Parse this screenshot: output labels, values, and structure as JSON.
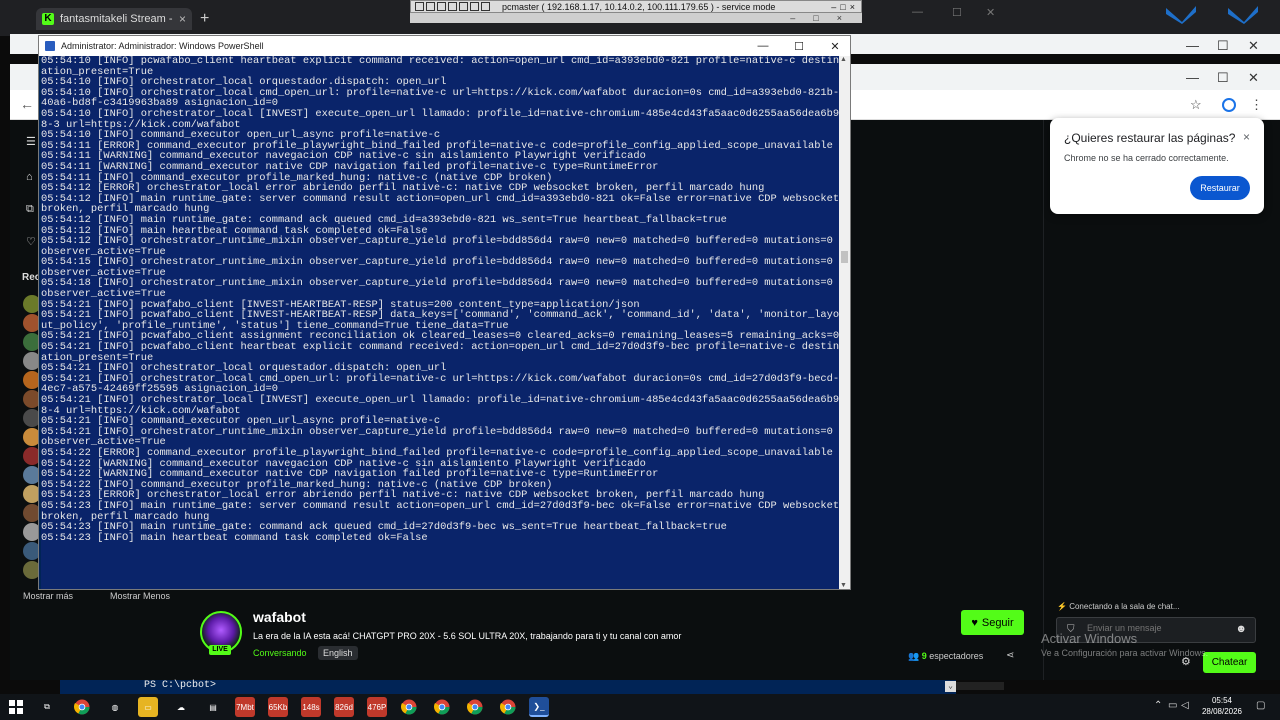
{
  "chrome": {
    "tab_title": "fantasmitakeli Stream - Watch",
    "tab_close": "×",
    "new_tab": "+",
    "kick_glyph": "K"
  },
  "service_bar": {
    "title": "pcmaster ( 192.168.1.17, 10.14.0.2, 100.111.179.65 ) - service mode",
    "min": "–",
    "max": "□",
    "close": "×"
  },
  "window_controls": {
    "min": "—",
    "max": "☐",
    "close": "✕"
  },
  "powershell": {
    "title": "Administrator: Administrador: Windows PowerShell",
    "lines": [
      "05:54:10 [INFO] pcwafabo_client heartbeat explicit command received: action=open_url cmd_id=a393ebd0-821 profile=native-c destination_present=True",
      "05:54:10 [INFO] orchestrator_local orquestador.dispatch: open_url",
      "05:54:10 [INFO] orchestrator_local cmd_open_url: profile=native-c url=https://kick.com/wafabot duracion=0s cmd_id=a393ebd0-821b-40a6-bd8f-c3419963ba89 asignacion_id=0",
      "05:54:10 [INFO] orchestrator_local [INVEST] execute_open_url llamado: profile_id=native-chromium-485e4cd43fa5aac0d6255aa56dea6b98-3 url=https://kick.com/wafabot",
      "05:54:10 [INFO] command_executor open_url_async profile=native-c",
      "05:54:11 [ERROR] command_executor profile_playwright_bind_failed profile=native-c code=profile_config_applied_scope_unavailable",
      "05:54:11 [WARNING] command_executor navegacion CDP native-c sin aislamiento Playwright verificado",
      "05:54:11 [WARNING] command_executor native CDP navigation failed profile=native-c type=RuntimeError",
      "05:54:11 [INFO] command_executor profile_marked_hung: native-c (native CDP broken)",
      "05:54:12 [ERROR] orchestrator_local error abriendo perfil native-c: native CDP websocket broken, perfil marcado hung",
      "05:54:12 [INFO] main runtime_gate: server command result action=open_url cmd_id=a393ebd0-821 ok=False error=native CDP websocket broken, perfil marcado hung",
      "05:54:12 [INFO] main runtime_gate: command ack queued cmd_id=a393ebd0-821 ws_sent=True heartbeat_fallback=true",
      "05:54:12 [INFO] main heartbeat command task completed ok=False",
      "05:54:12 [INFO] orchestrator_runtime_mixin observer_capture_yield profile=bdd856d4 raw=0 new=0 matched=0 buffered=0 mutations=0 observer_active=True",
      "05:54:15 [INFO] orchestrator_runtime_mixin observer_capture_yield profile=bdd856d4 raw=0 new=0 matched=0 buffered=0 mutations=0 observer_active=True",
      "05:54:18 [INFO] orchestrator_runtime_mixin observer_capture_yield profile=bdd856d4 raw=0 new=0 matched=0 buffered=0 mutations=0 observer_active=True",
      "05:54:21 [INFO] pcwafabo_client [INVEST-HEARTBEAT-RESP] status=200 content_type=application/json",
      "05:54:21 [INFO] pcwafabo_client [INVEST-HEARTBEAT-RESP] data_keys=['command', 'command_ack', 'command_id', 'data', 'monitor_layout_policy', 'profile_runtime', 'status'] tiene_command=True tiene_data=True",
      "05:54:21 [INFO] pcwafabo_client assignment reconciliation ok cleared_leases=0 cleared_acks=0 remaining_leases=5 remaining_acks=0",
      "05:54:21 [INFO] pcwafabo_client heartbeat explicit command received: action=open_url cmd_id=27d0d3f9-bec profile=native-c destination_present=True",
      "05:54:21 [INFO] orchestrator_local orquestador.dispatch: open_url",
      "05:54:21 [INFO] orchestrator_local cmd_open_url: profile=native-c url=https://kick.com/wafabot duracion=0s cmd_id=27d0d3f9-becd-4ec7-a575-42469ff25595 asignacion_id=0",
      "05:54:21 [INFO] orchestrator_local [INVEST] execute_open_url llamado: profile_id=native-chromium-485e4cd43fa5aac0d6255aa56dea6b98-4 url=https://kick.com/wafabot",
      "05:54:21 [INFO] command_executor open_url_async profile=native-c",
      "05:54:21 [INFO] orchestrator_runtime_mixin observer_capture_yield profile=bdd856d4 raw=0 new=0 matched=0 buffered=0 mutations=0 observer_active=True",
      "05:54:22 [ERROR] command_executor profile_playwright_bind_failed profile=native-c code=profile_config_applied_scope_unavailable",
      "05:54:22 [WARNING] command_executor navegacion CDP native-c sin aislamiento Playwright verificado",
      "05:54:22 [WARNING] command_executor native CDP navigation failed profile=native-c type=RuntimeError",
      "05:54:22 [INFO] command_executor profile_marked_hung: native-c (native CDP broken)",
      "05:54:23 [ERROR] orchestrator_local error abriendo perfil native-c: native CDP websocket broken, perfil marcado hung",
      "05:54:23 [INFO] main runtime_gate: server command result action=open_url cmd_id=27d0d3f9-bec ok=False error=native CDP websocket broken, perfil marcado hung",
      "05:54:23 [INFO] main runtime_gate: command ack queued cmd_id=27d0d3f9-bec ws_sent=True heartbeat_fallback=true",
      "05:54:23 [INFO] main heartbeat command task completed ok=False"
    ],
    "prompt": "PS C:\\pcbot>"
  },
  "restore_popup": {
    "title": "¿Quieres restaurar las páginas?",
    "body": "Chrome no se ha cerrado correctamente.",
    "button": "Restaurar",
    "close": "×"
  },
  "sidebar": {
    "recommended_label": "Rec",
    "show_more": "Mostrar más",
    "show_less": "Mostrar Menos",
    "avatar_colors": [
      "#6b7a2a",
      "#a0522d",
      "#3b6e3b",
      "#888888",
      "#b5651d",
      "#7b4a2a",
      "#4a4a4a",
      "#c98b3b",
      "#8a2a2a",
      "#5a7a9a",
      "#c0a060",
      "#704a30",
      "#999999",
      "#3a5a7a",
      "#6a6a3a"
    ]
  },
  "stream": {
    "name": "wafabot",
    "title": "La era de la  IA esta acá! CHATGPT PRO 20X - 5.6 SOL ULTRA 20X, trabajando para ti y tu canal con amor",
    "category": "Conversando",
    "language": "English",
    "live_badge": "LIVE",
    "follow_label": "Seguir",
    "viewers_count": "9",
    "viewers_label": "espectadores"
  },
  "chat": {
    "connecting": "Conectando a la sala de chat...",
    "placeholder": "Enviar un mensaje",
    "send_button": "Chatear"
  },
  "windows_watermark": {
    "line1": "Activar Windows",
    "line2": "Ve a Configuración para activar Windows."
  },
  "taskbar": {
    "tiles": [
      {
        "label": "7Mbt",
        "color": "#c0392b"
      },
      {
        "label": "65Kb",
        "color": "#c0392b"
      },
      {
        "label": "148s",
        "color": "#c0392b"
      },
      {
        "label": "826d",
        "color": "#c0392b"
      },
      {
        "label": "476P",
        "color": "#c0392b"
      }
    ],
    "time": "05:54",
    "date": "28/08/2026"
  },
  "colors": {
    "kick_green": "#53fc18",
    "ps_blue": "#012456",
    "chrome_blue": "#0b57d0"
  }
}
